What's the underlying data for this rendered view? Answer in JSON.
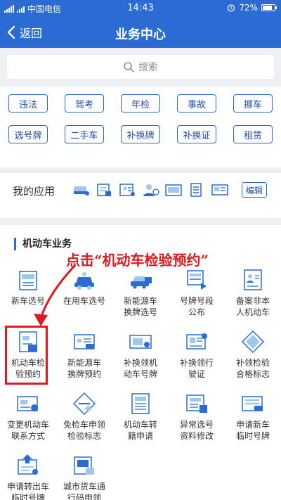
{
  "status_bar": {
    "carrier": "中国电信",
    "time": "14:43",
    "battery": "72%"
  },
  "header": {
    "back_label": "返回",
    "title": "业务中心"
  },
  "search": {
    "placeholder": "搜索"
  },
  "quick_tags": [
    "违法",
    "驾考",
    "年检",
    "事故",
    "挪车",
    "选号牌",
    "二手车",
    "补换牌",
    "补换证",
    "租赁"
  ],
  "my_apps": {
    "label": "我的应用",
    "edit_label": "编辑"
  },
  "section": {
    "title": "机动车业务",
    "annotation": "点击“机动车检验预约”",
    "items": [
      {
        "line1": "新车选号",
        "line2": "",
        "icon": "new-car-plate-icon"
      },
      {
        "line1": "在用车选号",
        "line2": "",
        "icon": "car-select-icon"
      },
      {
        "line1": "新能源车",
        "line2": "换牌选号",
        "icon": "ev-plate-icon"
      },
      {
        "line1": "号牌号段",
        "line2": "公布",
        "icon": "plate-range-icon"
      },
      {
        "line1": "备案非本",
        "line2": "人机动车",
        "icon": "filing-icon"
      },
      {
        "line1": "机动车检",
        "line2": "验预约",
        "icon": "inspection-booking-icon"
      },
      {
        "line1": "新能源车",
        "line2": "换牌预约",
        "icon": "ev-booking-icon"
      },
      {
        "line1": "补换领机",
        "line2": "动车号牌",
        "icon": "plate-replace-icon"
      },
      {
        "line1": "补换领行",
        "line2": "驶证",
        "icon": "license-replace-icon"
      },
      {
        "line1": "补领检验",
        "line2": "合格标志",
        "icon": "inspection-mark-icon"
      },
      {
        "line1": "变更机动车",
        "line2": "联系方式",
        "icon": "contact-change-icon"
      },
      {
        "line1": "免检车申领",
        "line2": "检验标志",
        "icon": "exempt-mark-icon"
      },
      {
        "line1": "机动车转",
        "line2": "籍申请",
        "icon": "transfer-icon"
      },
      {
        "line1": "异常选号",
        "line2": "资料修改",
        "icon": "data-edit-icon"
      },
      {
        "line1": "申请新车",
        "line2": "临时号牌",
        "icon": "temp-plate-icon"
      },
      {
        "line1": "申请转出车",
        "line2": "临时号牌",
        "icon": "transfer-out-plate-icon"
      },
      {
        "line1": "城市货车通",
        "line2": "行码申领",
        "icon": "truck-pass-icon"
      }
    ]
  },
  "colors": {
    "primary": "#2a6cd3",
    "annotation": "#e0191f",
    "icon_light": "#9ec8ef"
  }
}
